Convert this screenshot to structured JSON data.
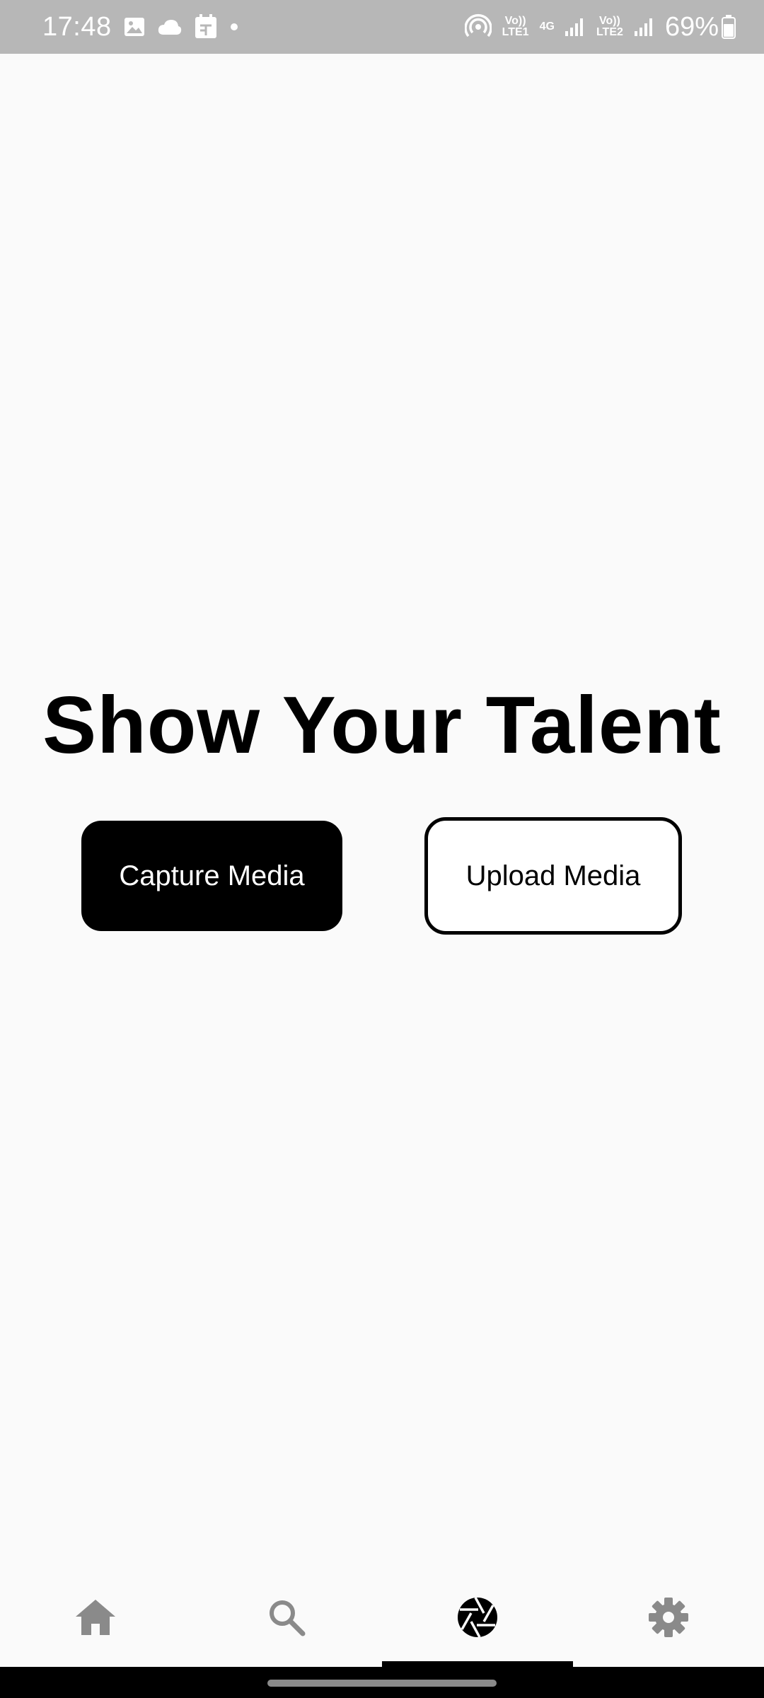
{
  "status_bar": {
    "time": "17:48",
    "lte1": "Vo)) LTE1",
    "net_type": "4G",
    "lte2": "Vo)) LTE2",
    "battery": "69%",
    "icons": [
      "image-icon",
      "cloud-icon",
      "calendar-icon",
      "dot-icon",
      "hotspot-icon",
      "signal-icon",
      "signal-icon",
      "battery-icon"
    ]
  },
  "main": {
    "title": "Show Your Talent",
    "capture_label": "Capture Media",
    "upload_label": "Upload Media"
  },
  "bottom_nav": {
    "items": [
      {
        "icon": "home-icon",
        "active": false
      },
      {
        "icon": "search-icon",
        "active": false
      },
      {
        "icon": "camera-aperture-icon",
        "active": true
      },
      {
        "icon": "settings-icon",
        "active": false
      }
    ],
    "colors": {
      "inactive": "#8a8a8a",
      "active": "#000000"
    }
  }
}
